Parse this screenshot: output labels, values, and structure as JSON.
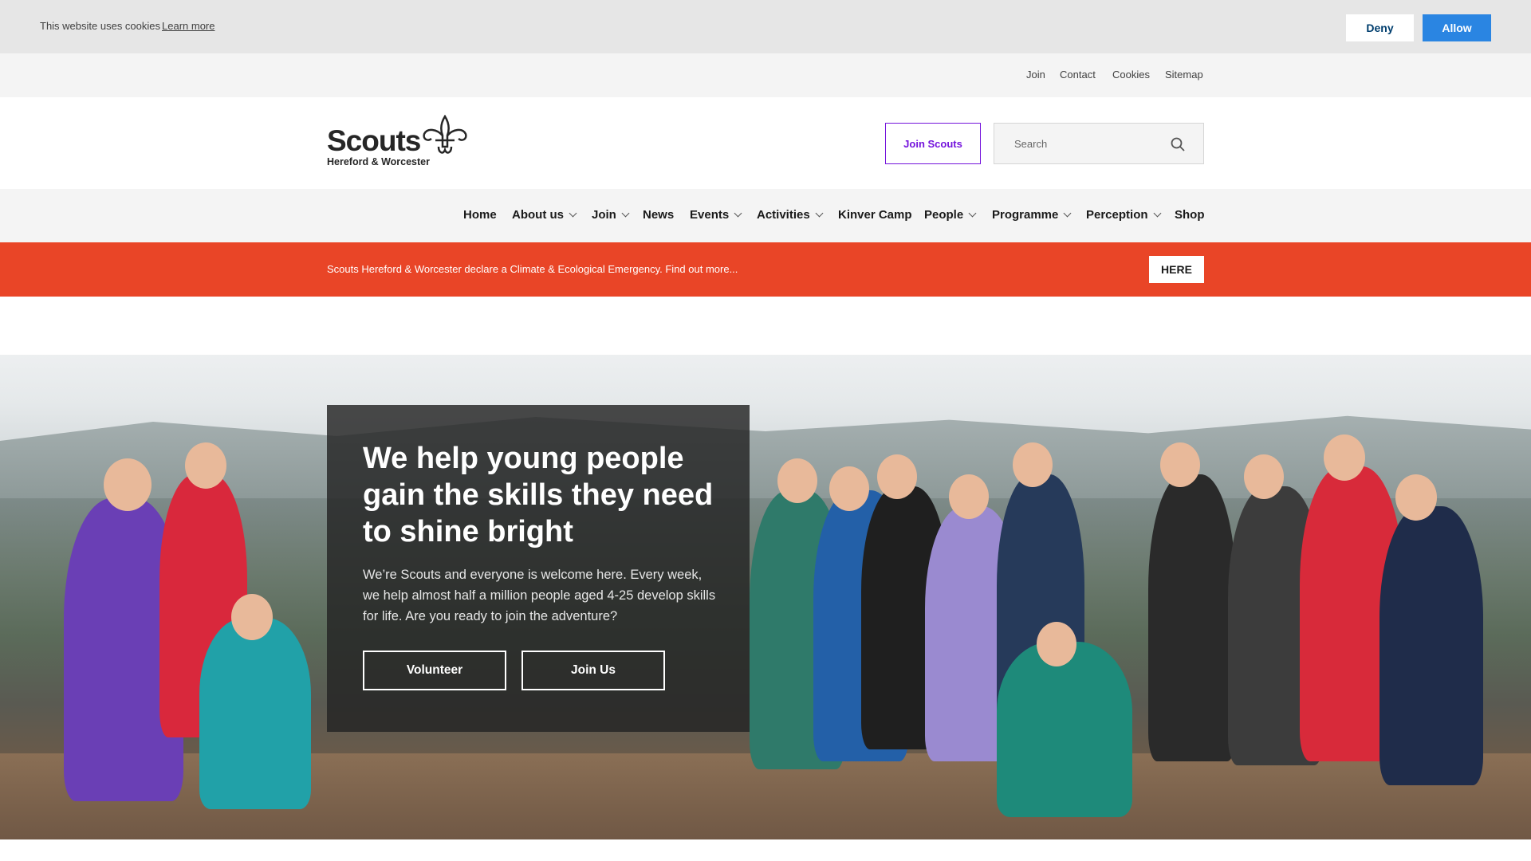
{
  "cookie_bar": {
    "message": "This website uses cookies",
    "learn_more": "Learn more",
    "deny_label": "Deny",
    "allow_label": "Allow",
    "allow_color": "#2a85e2"
  },
  "utility_nav": {
    "items": [
      {
        "label": "Join"
      },
      {
        "label": "Contact"
      },
      {
        "label": "Cookies"
      },
      {
        "label": "Sitemap"
      }
    ]
  },
  "header": {
    "logo_word": "Scouts",
    "logo_sub": "Hereford & Worcester",
    "logo_icon": "fleur-de-lis-icon",
    "join_button": "Join Scouts",
    "join_button_color": "#7413dc",
    "search_placeholder": "Search",
    "search_icon": "search-icon"
  },
  "main_nav": {
    "items": [
      {
        "label": "Home",
        "has_dropdown": false
      },
      {
        "label": "About us",
        "has_dropdown": true
      },
      {
        "label": "Join",
        "has_dropdown": true
      },
      {
        "label": "News",
        "has_dropdown": false
      },
      {
        "label": "Events",
        "has_dropdown": true
      },
      {
        "label": "Activities",
        "has_dropdown": true
      },
      {
        "label": "Kinver Camp",
        "has_dropdown": false
      },
      {
        "label": "People",
        "has_dropdown": true
      },
      {
        "label": "Programme",
        "has_dropdown": true
      },
      {
        "label": "Perception",
        "has_dropdown": true
      },
      {
        "label": "Shop",
        "has_dropdown": false
      }
    ]
  },
  "alert": {
    "text": "Scouts Hereford & Worcester declare a Climate & Ecological Emergency. Find out more...",
    "button": "HERE",
    "color": "#e94527"
  },
  "hero": {
    "title": "We help young people gain the skills they need to shine bright",
    "body": "We’re Scouts and everyone is welcome here. Every week, we help almost half a million people aged 4-25 develop skills for life. Are you ready to join the adventure?",
    "buttons": [
      {
        "label": "Volunteer"
      },
      {
        "label": "Join Us"
      }
    ]
  }
}
